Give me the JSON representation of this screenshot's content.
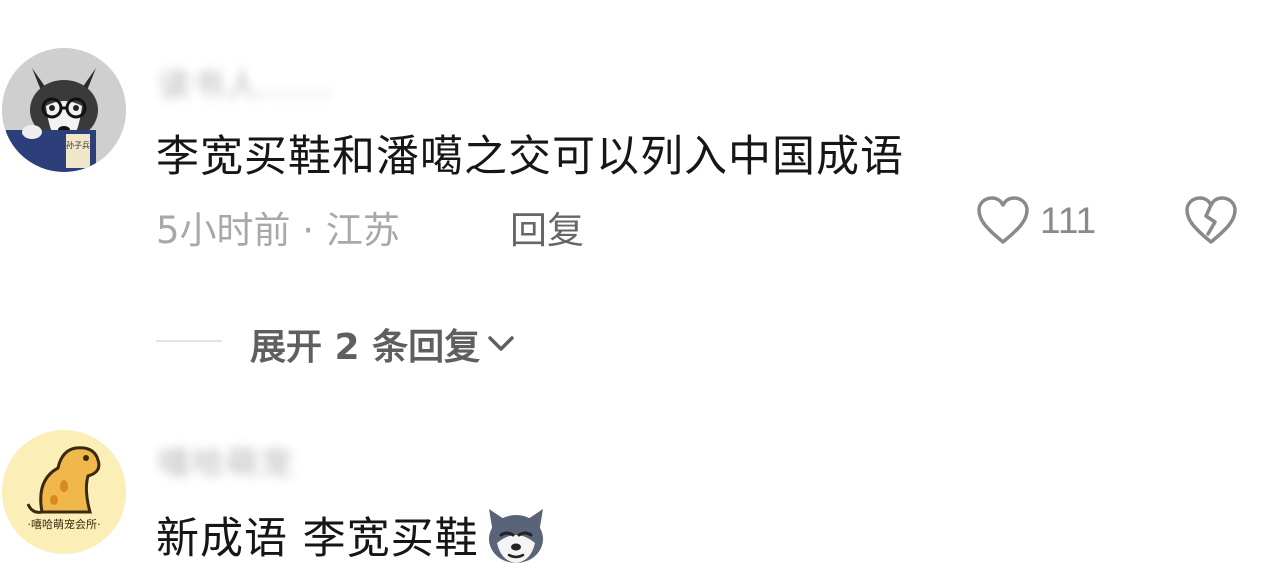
{
  "comments": [
    {
      "username": "读书人......",
      "text": "李宽买鞋和潘噶之交可以列入中国成语",
      "time_location": "5小时前 · 江苏",
      "reply_label": "回复",
      "likes": "111",
      "avatar_book_label": "孙子兵",
      "expand_label": "展开 2 条回复",
      "icons": [
        "heart-outline-icon",
        "broken-heart-icon",
        "chevron-down-icon"
      ]
    },
    {
      "username": "嘻哈萌宠",
      "text": "新成语 李宽买鞋",
      "emoji": "husky-dog-emoji",
      "avatar_banner": "·嘻哈萌宠会所·"
    }
  ],
  "colors": {
    "text": "#161616",
    "meta": "#a8a8a8",
    "reply": "#666666",
    "icon": "#8a8a8a",
    "avatar2_bg": "#fbeeb6"
  }
}
